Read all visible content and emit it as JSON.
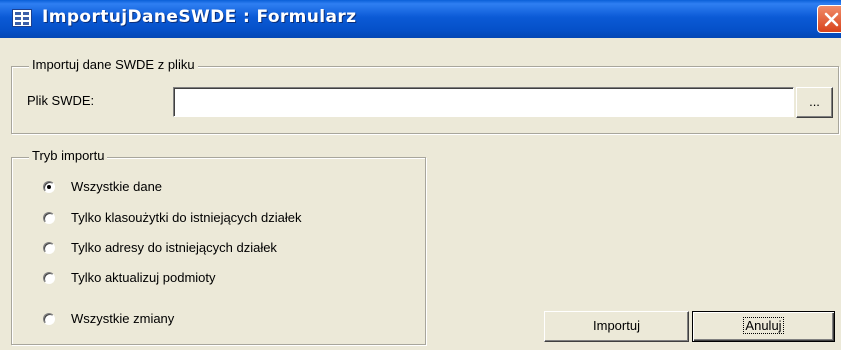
{
  "window": {
    "title": "ImportujDaneSWDE : Formularz"
  },
  "file_group": {
    "legend": "Importuj dane SWDE z pliku",
    "file_label": "Plik SWDE:",
    "file_value": "",
    "browse_label": "..."
  },
  "mode_group": {
    "legend": "Tryb importu",
    "options": [
      {
        "label": "Wszystkie dane",
        "checked": true
      },
      {
        "label": "Tylko klasoużytki do istniejących działek",
        "checked": false
      },
      {
        "label": "Tylko adresy do istniejących działek",
        "checked": false
      },
      {
        "label": "Tylko aktualizuj podmioty",
        "checked": false
      },
      {
        "label": "Wszystkie zmiany",
        "checked": false
      }
    ]
  },
  "buttons": {
    "import_label": "Importuj",
    "cancel_label": "Anuluj"
  },
  "colors": {
    "titlebar": "#0b5ad6",
    "face": "#ece9d8",
    "close": "#d8431b"
  }
}
